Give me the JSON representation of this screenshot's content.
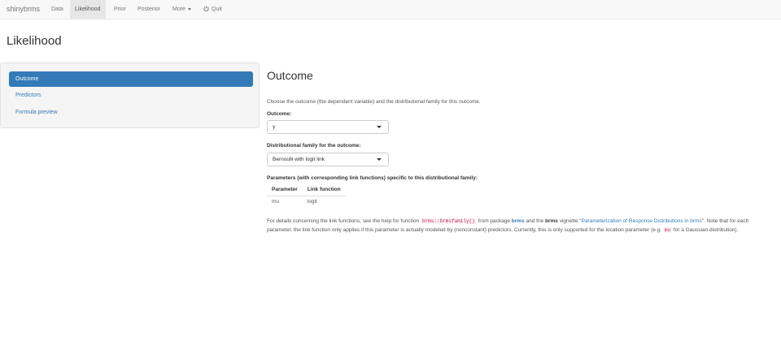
{
  "navbar": {
    "brand": "shinybrms",
    "items": [
      {
        "label": "Data"
      },
      {
        "label": "Likelihood"
      },
      {
        "label": "Prior"
      },
      {
        "label": "Posterior"
      },
      {
        "label": "More"
      },
      {
        "label": "Quit"
      }
    ],
    "active": "Likelihood"
  },
  "page": {
    "title": "Likelihood"
  },
  "sidebar": {
    "items": [
      {
        "label": "Outcome"
      },
      {
        "label": "Predictors"
      },
      {
        "label": "Formula preview"
      }
    ],
    "active": "Outcome"
  },
  "main": {
    "title": "Outcome",
    "intro": "Choose the outcome (the dependent variable) and the distributional family for this outcome.",
    "outcome_label": "Outcome:",
    "outcome_value": "y",
    "family_label": "Distributional family for the outcome:",
    "family_value": "Bernoulli with logit link",
    "params_label": "Parameters (with corresponding link functions) specific to this distributional family:",
    "params_table": {
      "headers": [
        "Parameter",
        "Link function"
      ],
      "rows": [
        [
          "mu",
          "logit"
        ]
      ]
    },
    "details": {
      "t1": "For details concerning the link functions, see the help for function ",
      "code1": "brms::brmsfamily()",
      "t2": " from package ",
      "pkg1": "brms",
      "t3": " and the ",
      "pkg2": "brms",
      "t4": " vignette \"",
      "link": "Parameterization of Response Distributions in brms",
      "t5": "\". Note that for each parameter, the link function only applies if this parameter is actually modeled by (nonconstant) predictors. Currently, this is only supported for the location parameter (e.g. ",
      "code2": "mu",
      "t6": " for a Gaussian distribution)."
    }
  },
  "colors": {
    "accent": "#337ab7",
    "navbar_bg": "#f8f8f8",
    "code": "#c7254e"
  }
}
